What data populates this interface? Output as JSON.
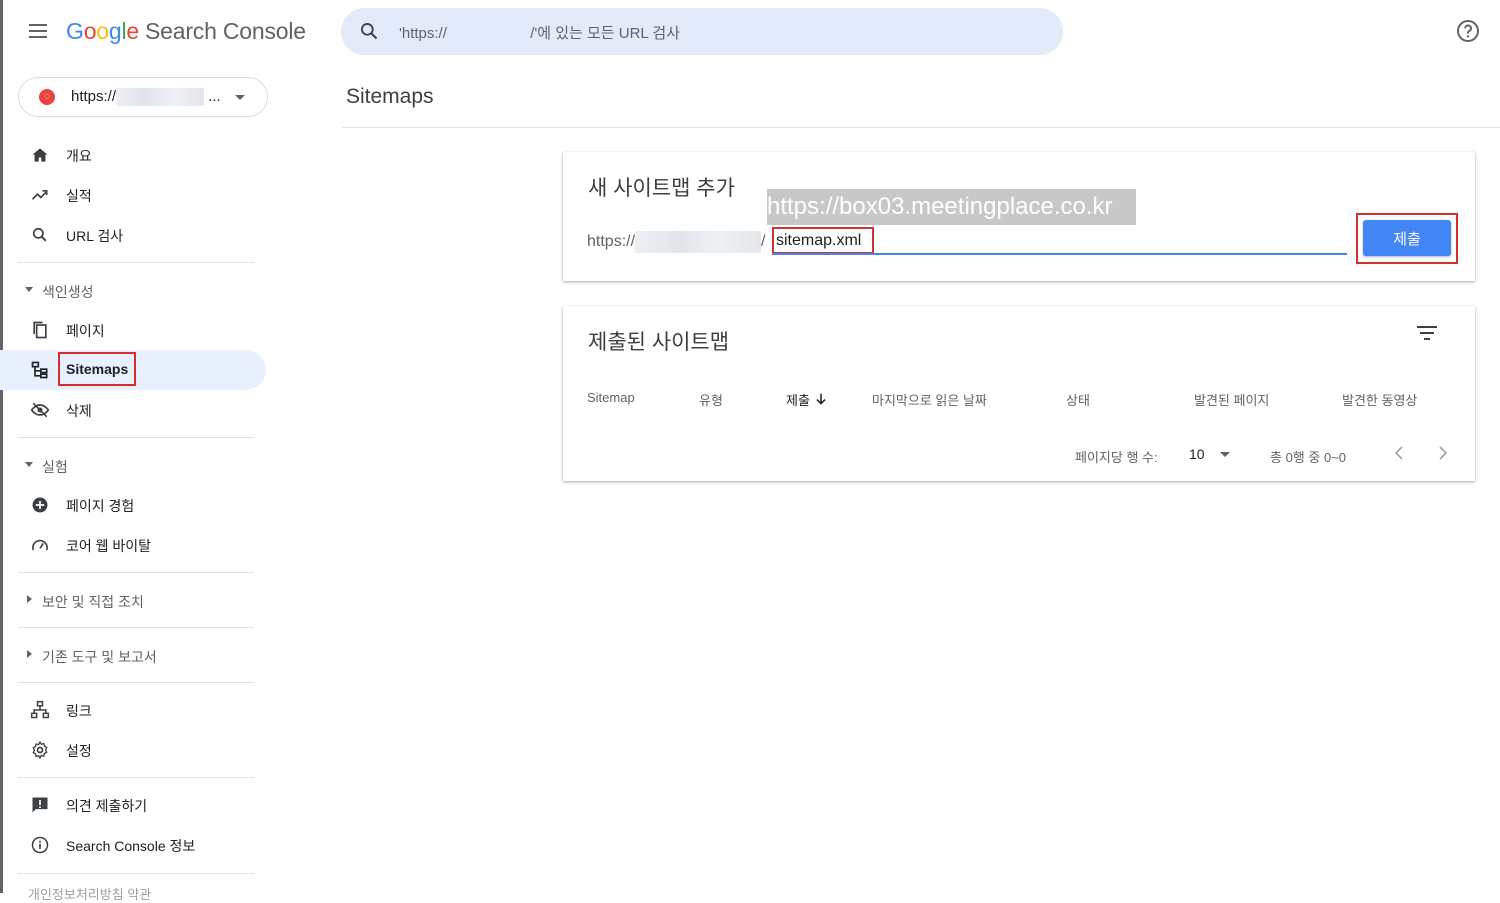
{
  "header": {
    "logo_letters": [
      "G",
      "o",
      "o",
      "g",
      "l",
      "e"
    ],
    "product": "Search Console",
    "search_placeholder": "'https://                    /'에 있는 모든 URL 검사"
  },
  "property": {
    "prefix": "https://",
    "ellipsis": "..."
  },
  "nav": {
    "overview": "개요",
    "performance": "실적",
    "url_inspection": "URL 검사",
    "indexing_section": "색인생성",
    "pages": "페이지",
    "sitemaps": "Sitemaps",
    "removals": "삭제",
    "experience_section": "실험",
    "page_experience": "페이지 경험",
    "core_web_vitals": "코어 웹 바이탈",
    "security_section": "보안 및 직접 조치",
    "legacy_section": "기존 도구 및 보고서",
    "links": "링크",
    "settings": "설정",
    "feedback": "의견 제출하기",
    "about": "Search Console 정보",
    "footer_cut": "개인정보처리방침   약관"
  },
  "main": {
    "page_title": "Sitemaps",
    "add_card": {
      "title": "새 사이트맵 추가",
      "url_prefix_start": "https://",
      "url_prefix_end": "/",
      "input_value": "sitemap.xml",
      "overlay_url": "https://box03.meetingplace.co.kr",
      "submit_label": "제출"
    },
    "submitted_card": {
      "title": "제출된 사이트맵",
      "columns": [
        "Sitemap",
        "유형",
        "제출",
        "마지막으로 읽은 날짜",
        "상태",
        "발견된 페이지",
        "발견한 동영상"
      ],
      "rows_per_page_label": "페이지당 행 수:",
      "rows_per_page_value": "10",
      "range_text": "총 0행 중 0~0"
    }
  }
}
